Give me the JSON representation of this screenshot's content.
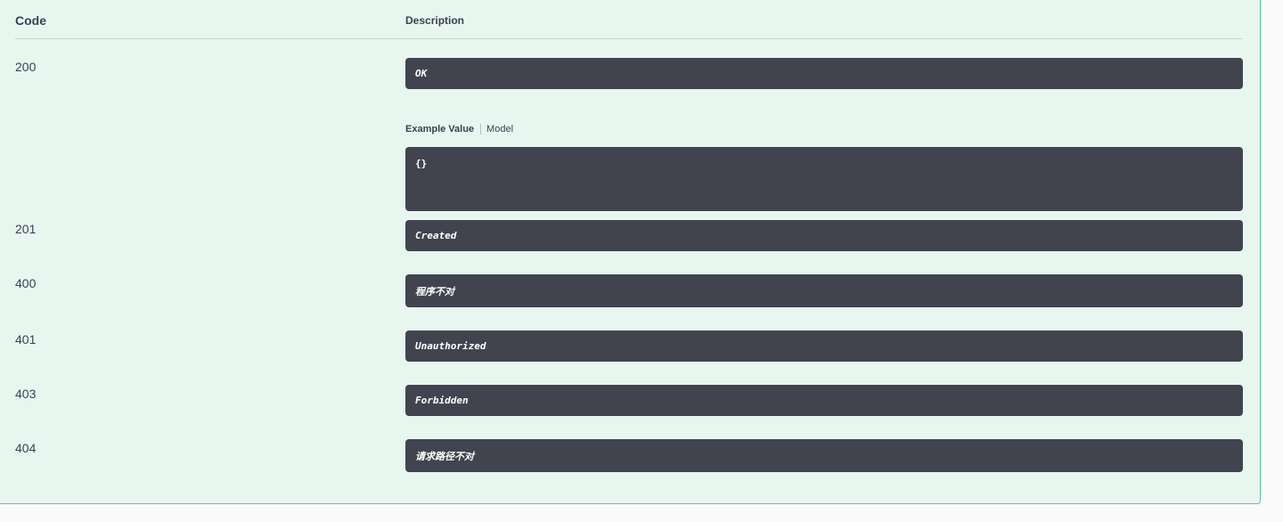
{
  "table": {
    "headers": {
      "code": "Code",
      "description": "Description"
    },
    "rows": [
      {
        "code": "200",
        "description": "OK"
      },
      {
        "code": "201",
        "description": "Created"
      },
      {
        "code": "400",
        "description": "程序不对"
      },
      {
        "code": "401",
        "description": "Unauthorized"
      },
      {
        "code": "403",
        "description": "Forbidden"
      },
      {
        "code": "404",
        "description": "请求路径不对"
      }
    ]
  },
  "example": {
    "tab_active": "Example Value",
    "tab_inactive": "Model",
    "value": "{}"
  },
  "colors": {
    "panel_background": "#e8f6f0",
    "panel_border": "#49cc90",
    "code_box_background": "#41444e",
    "text": "#3b4151"
  }
}
